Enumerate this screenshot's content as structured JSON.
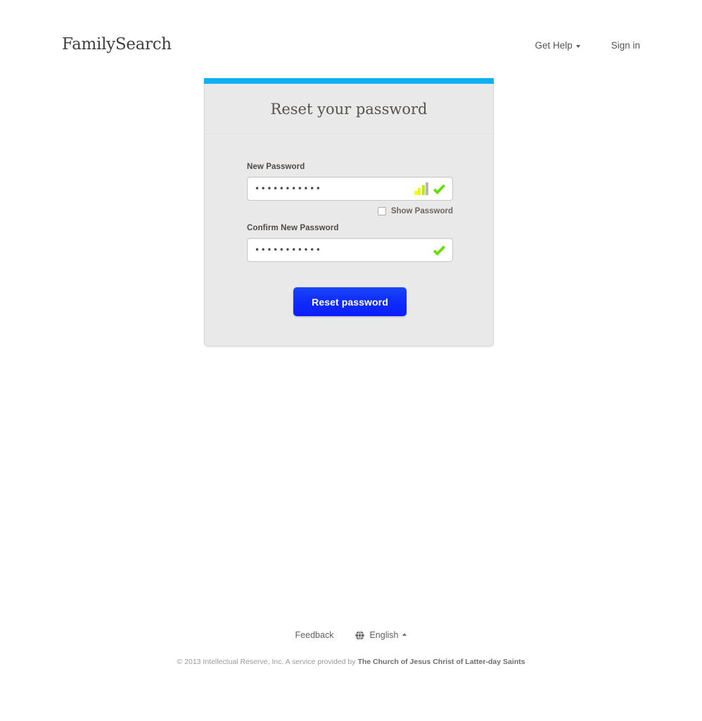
{
  "brand": {
    "logo_text": "FamilySearch",
    "accent_cyan": "#0bb0f0",
    "button_blue": "#0f2dfb"
  },
  "header": {
    "get_help_label": "Get Help",
    "sign_in_label": "Sign in"
  },
  "card": {
    "title": "Reset your password",
    "new_password": {
      "label": "New Password",
      "value": "•••••••••••",
      "placeholder": "",
      "strength_bars_total": 4,
      "strength_bars_filled": 3,
      "valid": true
    },
    "show_password": {
      "label": "Show Password",
      "checked": false
    },
    "confirm_password": {
      "label": "Confirm New Password",
      "value": "•••••••••••",
      "placeholder": "",
      "valid": true
    },
    "submit_label": "Reset password"
  },
  "footer": {
    "feedback_label": "Feedback",
    "language_label": "English",
    "copyright_prefix": "© 2013 Intellectual Reserve, Inc.  A service provided by ",
    "copyright_org": "The Church of Jesus Christ of Latter-day Saints"
  }
}
